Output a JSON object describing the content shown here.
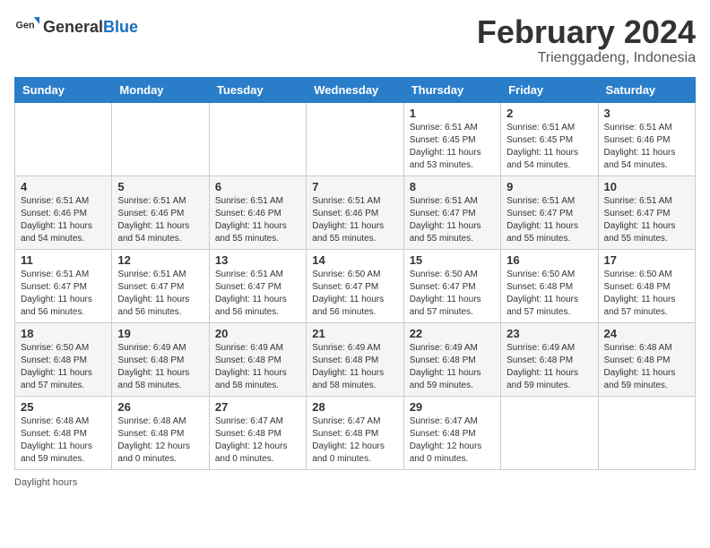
{
  "header": {
    "logo_general": "General",
    "logo_blue": "Blue",
    "month_title": "February 2024",
    "location": "Trienggadeng, Indonesia"
  },
  "days_of_week": [
    "Sunday",
    "Monday",
    "Tuesday",
    "Wednesday",
    "Thursday",
    "Friday",
    "Saturday"
  ],
  "weeks": [
    [
      {
        "day": "",
        "info": ""
      },
      {
        "day": "",
        "info": ""
      },
      {
        "day": "",
        "info": ""
      },
      {
        "day": "",
        "info": ""
      },
      {
        "day": "1",
        "info": "Sunrise: 6:51 AM\nSunset: 6:45 PM\nDaylight: 11 hours\nand 53 minutes."
      },
      {
        "day": "2",
        "info": "Sunrise: 6:51 AM\nSunset: 6:45 PM\nDaylight: 11 hours\nand 54 minutes."
      },
      {
        "day": "3",
        "info": "Sunrise: 6:51 AM\nSunset: 6:46 PM\nDaylight: 11 hours\nand 54 minutes."
      }
    ],
    [
      {
        "day": "4",
        "info": "Sunrise: 6:51 AM\nSunset: 6:46 PM\nDaylight: 11 hours\nand 54 minutes."
      },
      {
        "day": "5",
        "info": "Sunrise: 6:51 AM\nSunset: 6:46 PM\nDaylight: 11 hours\nand 54 minutes."
      },
      {
        "day": "6",
        "info": "Sunrise: 6:51 AM\nSunset: 6:46 PM\nDaylight: 11 hours\nand 55 minutes."
      },
      {
        "day": "7",
        "info": "Sunrise: 6:51 AM\nSunset: 6:46 PM\nDaylight: 11 hours\nand 55 minutes."
      },
      {
        "day": "8",
        "info": "Sunrise: 6:51 AM\nSunset: 6:47 PM\nDaylight: 11 hours\nand 55 minutes."
      },
      {
        "day": "9",
        "info": "Sunrise: 6:51 AM\nSunset: 6:47 PM\nDaylight: 11 hours\nand 55 minutes."
      },
      {
        "day": "10",
        "info": "Sunrise: 6:51 AM\nSunset: 6:47 PM\nDaylight: 11 hours\nand 55 minutes."
      }
    ],
    [
      {
        "day": "11",
        "info": "Sunrise: 6:51 AM\nSunset: 6:47 PM\nDaylight: 11 hours\nand 56 minutes."
      },
      {
        "day": "12",
        "info": "Sunrise: 6:51 AM\nSunset: 6:47 PM\nDaylight: 11 hours\nand 56 minutes."
      },
      {
        "day": "13",
        "info": "Sunrise: 6:51 AM\nSunset: 6:47 PM\nDaylight: 11 hours\nand 56 minutes."
      },
      {
        "day": "14",
        "info": "Sunrise: 6:50 AM\nSunset: 6:47 PM\nDaylight: 11 hours\nand 56 minutes."
      },
      {
        "day": "15",
        "info": "Sunrise: 6:50 AM\nSunset: 6:47 PM\nDaylight: 11 hours\nand 57 minutes."
      },
      {
        "day": "16",
        "info": "Sunrise: 6:50 AM\nSunset: 6:48 PM\nDaylight: 11 hours\nand 57 minutes."
      },
      {
        "day": "17",
        "info": "Sunrise: 6:50 AM\nSunset: 6:48 PM\nDaylight: 11 hours\nand 57 minutes."
      }
    ],
    [
      {
        "day": "18",
        "info": "Sunrise: 6:50 AM\nSunset: 6:48 PM\nDaylight: 11 hours\nand 57 minutes."
      },
      {
        "day": "19",
        "info": "Sunrise: 6:49 AM\nSunset: 6:48 PM\nDaylight: 11 hours\nand 58 minutes."
      },
      {
        "day": "20",
        "info": "Sunrise: 6:49 AM\nSunset: 6:48 PM\nDaylight: 11 hours\nand 58 minutes."
      },
      {
        "day": "21",
        "info": "Sunrise: 6:49 AM\nSunset: 6:48 PM\nDaylight: 11 hours\nand 58 minutes."
      },
      {
        "day": "22",
        "info": "Sunrise: 6:49 AM\nSunset: 6:48 PM\nDaylight: 11 hours\nand 59 minutes."
      },
      {
        "day": "23",
        "info": "Sunrise: 6:49 AM\nSunset: 6:48 PM\nDaylight: 11 hours\nand 59 minutes."
      },
      {
        "day": "24",
        "info": "Sunrise: 6:48 AM\nSunset: 6:48 PM\nDaylight: 11 hours\nand 59 minutes."
      }
    ],
    [
      {
        "day": "25",
        "info": "Sunrise: 6:48 AM\nSunset: 6:48 PM\nDaylight: 11 hours\nand 59 minutes."
      },
      {
        "day": "26",
        "info": "Sunrise: 6:48 AM\nSunset: 6:48 PM\nDaylight: 12 hours\nand 0 minutes."
      },
      {
        "day": "27",
        "info": "Sunrise: 6:47 AM\nSunset: 6:48 PM\nDaylight: 12 hours\nand 0 minutes."
      },
      {
        "day": "28",
        "info": "Sunrise: 6:47 AM\nSunset: 6:48 PM\nDaylight: 12 hours\nand 0 minutes."
      },
      {
        "day": "29",
        "info": "Sunrise: 6:47 AM\nSunset: 6:48 PM\nDaylight: 12 hours\nand 0 minutes."
      },
      {
        "day": "",
        "info": ""
      },
      {
        "day": "",
        "info": ""
      }
    ]
  ],
  "footer": {
    "daylight_hours_label": "Daylight hours"
  }
}
